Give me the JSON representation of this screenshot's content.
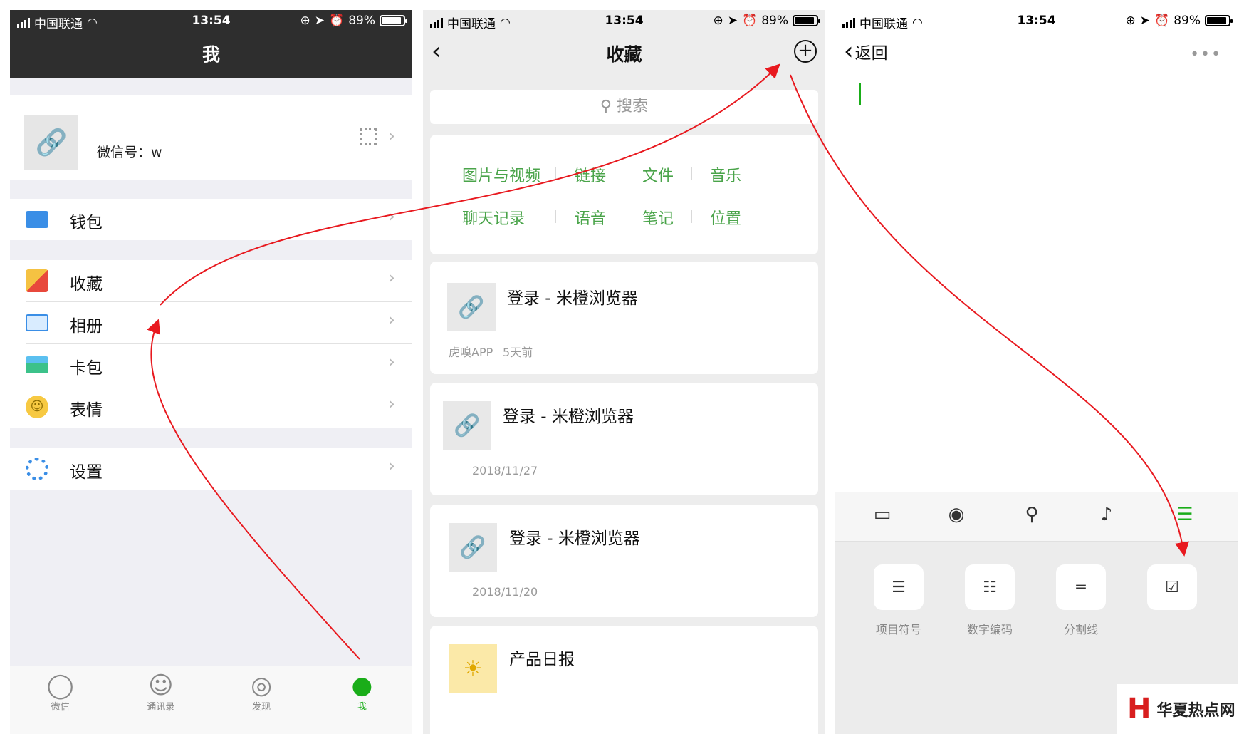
{
  "status": {
    "carrier": "中国联通",
    "time": "13:54",
    "battery": "89%",
    "battery_level": 0.89
  },
  "screen1": {
    "title": "我",
    "profile": {
      "wechat_id": "微信号：w"
    },
    "menu": [
      {
        "label": "钱包"
      },
      {
        "label": "收藏"
      },
      {
        "label": "相册"
      },
      {
        "label": "卡包"
      },
      {
        "label": "表情"
      },
      {
        "label": "设置"
      }
    ],
    "tabs": [
      {
        "label": "微信"
      },
      {
        "label": "通讯录"
      },
      {
        "label": "发现"
      },
      {
        "label": "我"
      }
    ]
  },
  "screen2": {
    "title": "收藏",
    "search_placeholder": "搜索",
    "categories": [
      "图片与视频",
      "链接",
      "文件",
      "音乐",
      "聊天记录",
      "语音",
      "笔记",
      "位置"
    ],
    "items": [
      {
        "title": "登录 - 米橙浏览器",
        "source": "虎嗅APP",
        "time": "5天前"
      },
      {
        "title": "登录 - 米橙浏览器",
        "time": "2018/11/27"
      },
      {
        "title": "登录 - 米橙浏览器",
        "time": "2018/11/20"
      },
      {
        "title": "产品日报"
      }
    ]
  },
  "screen3": {
    "back_label": "返回",
    "format_options": [
      {
        "label": "项目符号"
      },
      {
        "label": "数字编码"
      },
      {
        "label": "分割线"
      },
      {
        "label": ""
      }
    ],
    "watermark": "华夏热点网"
  },
  "colors": {
    "accent": "#1aad19",
    "arrow": "#e8191f",
    "navbar": "#2e2e2e"
  }
}
